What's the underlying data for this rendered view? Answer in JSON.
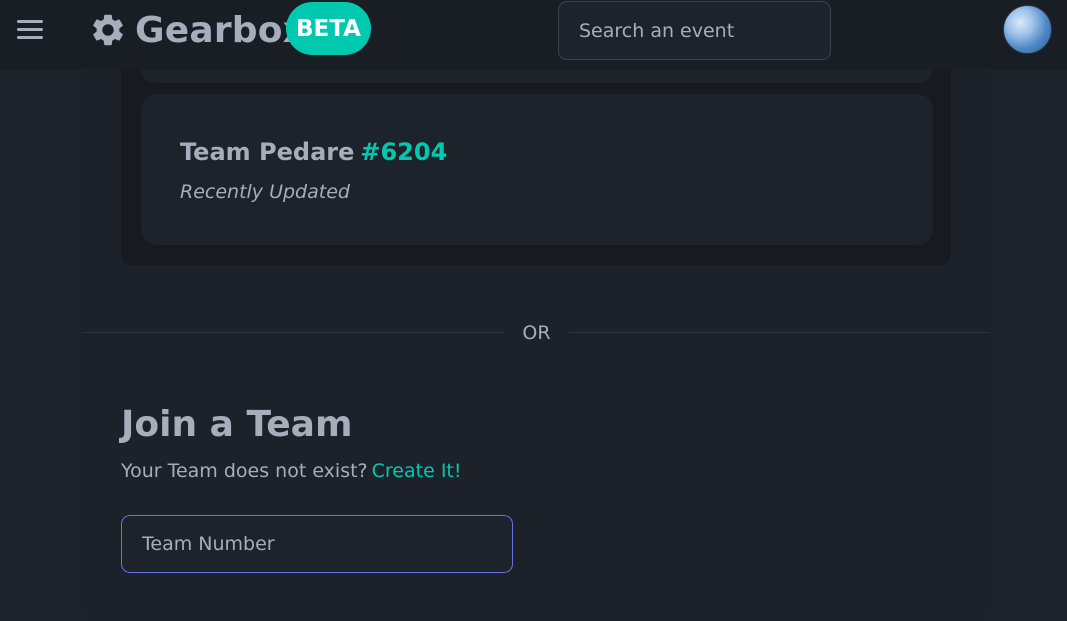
{
  "navbar": {
    "menu_icon": "hamburger-icon",
    "brand_icon": "gear-icon",
    "brand_title": "Gearbox",
    "badge": "BETA",
    "search_placeholder": "Search an event",
    "avatar_icon": "user-avatar"
  },
  "teams": [
    {
      "name": "Team Pedare",
      "number": "#6204",
      "status": "Recently Updated"
    }
  ],
  "divider": "OR",
  "join": {
    "title": "Join a Team",
    "prompt": "Your Team does not exist?",
    "create_link": "Create It!",
    "input_placeholder": "Team Number"
  },
  "colors": {
    "accent": "#00c9b0",
    "background": "#1d232a",
    "navbar": "#191e24",
    "text": "#a6adbb",
    "input_focus_border": "#6c70e6"
  }
}
